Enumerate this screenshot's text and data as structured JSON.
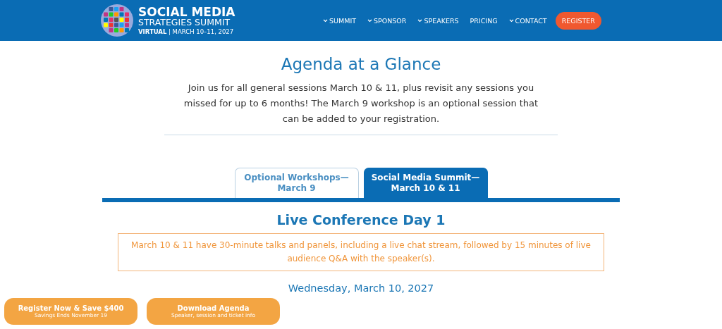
{
  "header": {
    "logo": {
      "title": "SOCIAL MEDIA",
      "subtitle": "STRATEGIES SUMMIT",
      "tag": "VIRTUAL",
      "dates": "| MARCH 10–11, 2027"
    },
    "nav": [
      {
        "label": "SUMMIT",
        "dropdown": true
      },
      {
        "label": "SPONSOR",
        "dropdown": true
      },
      {
        "label": "SPEAKERS",
        "dropdown": true
      },
      {
        "label": "PRICING",
        "dropdown": false
      },
      {
        "label": "CONTACT",
        "dropdown": true
      }
    ],
    "cta": "REGISTER"
  },
  "intro": {
    "title": "Agenda at a Glance",
    "text": "Join us for all general sessions March 10 & 11, plus revisit any sessions you missed for up to 6 months! The March 9 workshop is an optional session that can be added to your registration."
  },
  "tabs": [
    {
      "label": "Optional Workshops—\nMarch 9",
      "selected": false
    },
    {
      "label": "Social Media Summit—\nMarch 10 & 11",
      "selected": true
    }
  ],
  "day": {
    "title": "Live Conference Day 1",
    "notice": "March 10 & 11 have 30-minute talks and panels, including a live chat stream, followed by 15 minutes of live audience Q&A with the speaker(s).",
    "date": "Wednesday, March 10, 2027"
  },
  "floating_buttons": [
    {
      "label": "Register Now & Save $400",
      "sub": "Savings Ends November 19"
    },
    {
      "label": "Download Agenda",
      "sub": "Speaker, session and ticket info"
    }
  ]
}
